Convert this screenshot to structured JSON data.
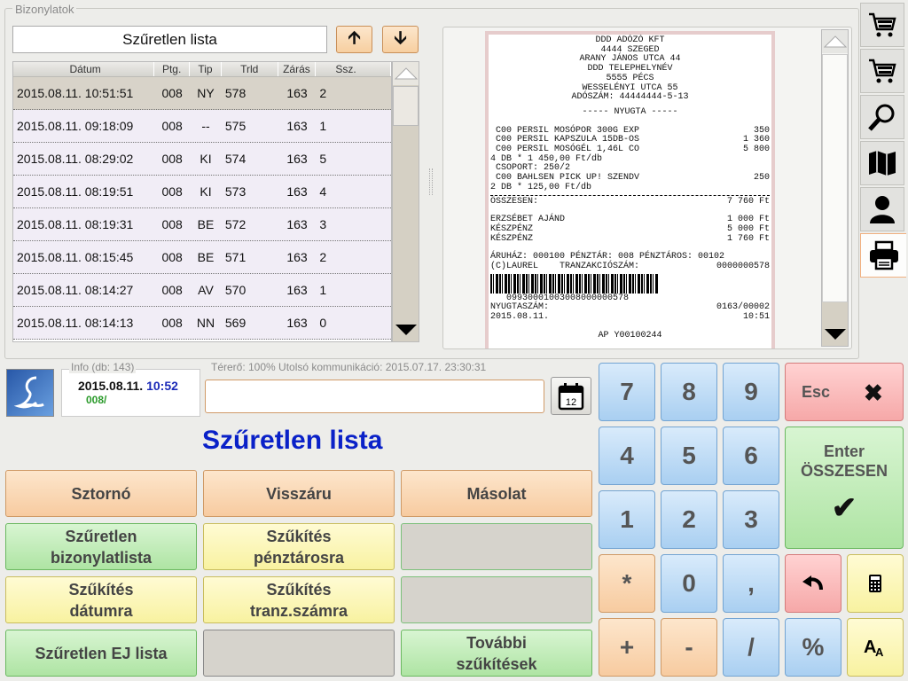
{
  "group_title": "Bizonylatok",
  "list_title": "Szűretlen lista",
  "table": {
    "headers": [
      "Dátum",
      "Ptg.",
      "Tip",
      "Trld",
      "Zárás",
      "Ssz."
    ],
    "rows": [
      [
        "2015.08.11. 10:51:51",
        "008",
        "NY",
        "578",
        "163",
        "2"
      ],
      [
        "2015.08.11. 09:18:09",
        "008",
        "--",
        "575",
        "163",
        "1"
      ],
      [
        "2015.08.11. 08:29:02",
        "008",
        "KI",
        "574",
        "163",
        "5"
      ],
      [
        "2015.08.11. 08:19:51",
        "008",
        "KI",
        "573",
        "163",
        "4"
      ],
      [
        "2015.08.11. 08:19:31",
        "008",
        "BE",
        "572",
        "163",
        "3"
      ],
      [
        "2015.08.11. 08:15:45",
        "008",
        "BE",
        "571",
        "163",
        "2"
      ],
      [
        "2015.08.11. 08:14:27",
        "008",
        "AV",
        "570",
        "163",
        "1"
      ],
      [
        "2015.08.11. 08:14:13",
        "008",
        "NN",
        "569",
        "163",
        "0"
      ]
    ]
  },
  "receipt": {
    "header": [
      "DDD ADÓZÓ KFT",
      "4444 SZEGED",
      "ARANY JÁNOS UTCA 44",
      "DDD TELEPHELYNÉV",
      "5555 PÉCS",
      "WESSELÉNYI UTCA 55",
      "ADÓSZÁM: 44444444-5-13"
    ],
    "type": "----- NYUGTA -----",
    "items": [
      {
        "name": " C00 PERSIL MOSÓPOR 300G EXP",
        "value": "350"
      },
      {
        "name": " C00 PERSIL KAPSZULA 15DB-OS",
        "value": "1 360"
      },
      {
        "name": " C00 PERSIL MOSÓGÉL 1,46L CO",
        "value": "5 800"
      },
      {
        "name": "4 DB * 1 450,00 Ft/db",
        "value": ""
      },
      {
        "name": " CSOPORT: 250/2",
        "value": ""
      },
      {
        "name": " C00 BAHLSEN PICK UP! SZENDV",
        "value": "250"
      },
      {
        "name": "2 DB * 125,00 Ft/db",
        "value": ""
      }
    ],
    "total_label": "ÖSSZESEN:",
    "total_value": "7 760 Ft",
    "payments": [
      {
        "name": "ERZSÉBET AJÁND",
        "value": "1 000 Ft"
      },
      {
        "name": "KÉSZPÉNZ",
        "value": "5 000 Ft"
      },
      {
        "name": "KÉSZPÉNZ",
        "value": "1 760 Ft"
      }
    ],
    "store_line": "ÁRUHÁZ: 000100 PÉNZTÁR: 008 PÉNZTÁROS: 00102",
    "tran_label": "(C)LAUREL    TRANZAKCIÓSZÁM:",
    "tran_value": "0000000578",
    "barcode_text": "   09930001003008000000578",
    "receipt_no_label": "NYUGTASZÁM:",
    "receipt_no_value": "0163/00002",
    "date": "2015.08.11.",
    "time": "10:51",
    "ap": "AP Y00100244"
  },
  "info": {
    "caption": "Info (db: 143)",
    "date": "2015.08.11.",
    "time": "10:52",
    "code": "008/"
  },
  "entry": {
    "caption": "Térerő: 100%  Utolsó kommunikáció: 2015.07.17. 23:30:31",
    "value": ""
  },
  "calendar_day": "12",
  "big_title": "Szűretlen lista",
  "buttons": {
    "storno": "Sztornó",
    "visszaru": "Visszáru",
    "masolat": "Másolat",
    "szuretlen_biz": "Szűretlen\nbizonylatlista",
    "szukites_penztaros": "Szűkítés\npénztárosra",
    "szukites_datum": "Szűkítés\ndátumra",
    "szukites_tranz": "Szűkítés\ntranz.számra",
    "szuretlen_ej": "Szűretlen EJ lista",
    "tovabbi": "További\nszűkítések"
  },
  "keypad": {
    "k7": "7",
    "k8": "8",
    "k9": "9",
    "k4": "4",
    "k5": "5",
    "k6": "6",
    "k1": "1",
    "k2": "2",
    "k3": "3",
    "kstar": "*",
    "k0": "0",
    "kcomma": ",",
    "kplus": "+",
    "kminus": "-",
    "kslash": "/",
    "kpercent": "%",
    "esc": "Esc",
    "enter_line1": "Enter",
    "enter_line2": "ÖSSZESEN"
  }
}
